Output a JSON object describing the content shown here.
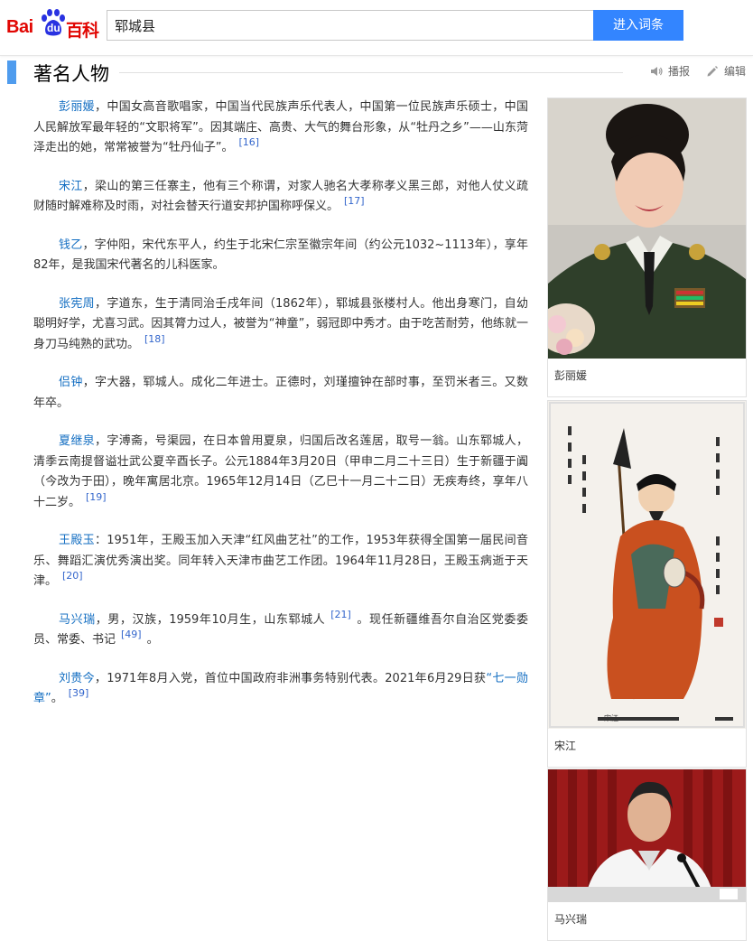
{
  "header": {
    "logo_bai": "Bai",
    "logo_du": "du",
    "logo_baike": "百科",
    "search_value": "郓城县",
    "search_button": "进入词条"
  },
  "section": {
    "title": "著名人物",
    "listen_label": "播报",
    "edit_label": "编辑"
  },
  "people": [
    {
      "name": "彭丽媛",
      "text": "，中国女高音歌唱家，中国当代民族声乐代表人，中国第一位民族声乐硕士，中国人民解放军最年轻的“文职将军”。因其端庄、高贵、大气的舞台形象，从“牡丹之乡”——山东菏泽走出的她，常常被誉为“牡丹仙子”。",
      "ref": "[16]"
    },
    {
      "name": "宋江",
      "text": "，梁山的第三任寨主，他有三个称谓，对家人驰名大孝称孝义黑三郎，对他人仗义疏财随时解难称及时雨，对社会替天行道安邦护国称呼保义。",
      "ref": "[17]"
    },
    {
      "name": "钱乙",
      "text": "，字仲阳，宋代东平人，约生于北宋仁宗至徽宗年间（约公元1032~1113年），享年82年，是我国宋代著名的儿科医家。",
      "ref": ""
    },
    {
      "name": "张宪周",
      "text": "，字道东，生于清同治壬戌年间（1862年），郓城县张楼村人。他出身寒门，自幼聪明好学，尤喜习武。因其膂力过人，被誉为“神童”，弱冠即中秀才。由于吃苦耐劳，他练就一身刀马纯熟的武功。",
      "ref": "[18]"
    },
    {
      "name": "侣钟",
      "text": "，字大器，郓城人。成化二年进士。正德时，刘瑾擅钟在部时事，至罚米者三。又数年卒。",
      "ref": ""
    },
    {
      "name": "夏继泉",
      "text": "，字溥斋，号渠园，在日本曾用夏泉，归国后改名莲居，取号一翁。山东郓城人，清季云南提督谥壮武公夏辛酉长子。公元1884年3月20日（甲申二月二十三日）生于新疆于阗（今改为于田），晚年寓居北京。1965年12月14日（乙巳十一月二十二日）无疾寿终，享年八十二岁。",
      "ref": "[19]"
    },
    {
      "name": "王殿玉",
      "text": "：1951年，王殿玉加入天津“红风曲艺社”的工作，1953年获得全国第一届民间音乐、舞蹈汇演优秀演出奖。同年转入天津市曲艺工作团。1964年11月28日，王殿玉病逝于天津。",
      "ref": "[20]"
    },
    {
      "name": "马兴瑞",
      "text": "，男，汉族，1959年10月生，山东郓城人",
      "ref": "[21]",
      "text2": "。现任新疆维吾尔自治区党委委员、常委、书记",
      "ref2": "[49]",
      "text3": "。"
    },
    {
      "name": "刘贵今",
      "text": "，1971年8月入党，首位中国政府非洲事务特别代表。2021年6月29日获",
      "link": "“七一勋章”",
      "text2": "。",
      "ref": "[39]"
    }
  ],
  "images": [
    {
      "caption": "彭丽媛",
      "icon": "portrait-photo"
    },
    {
      "caption": "宋江",
      "icon": "ink-painting",
      "inscription": "宋江"
    },
    {
      "caption": "马兴瑞",
      "icon": "speaker-photo"
    }
  ],
  "colors": {
    "accent": "#3385ff",
    "brand": "#e10602",
    "link": "#136ec2",
    "section_bar": "#4f9cee"
  }
}
